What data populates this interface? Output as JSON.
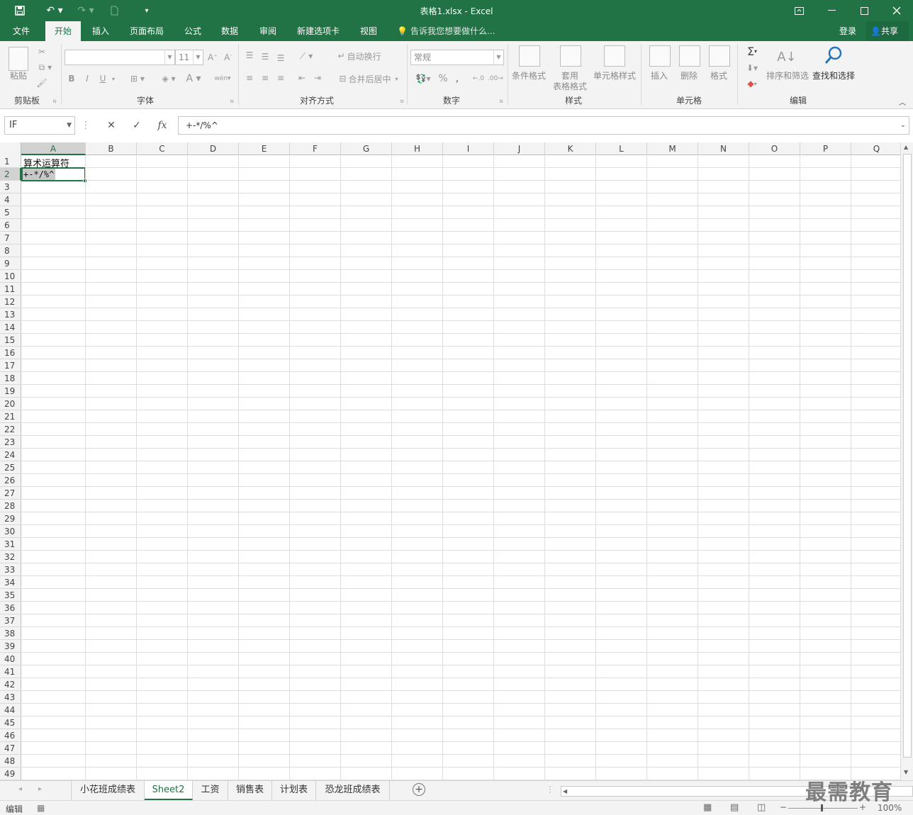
{
  "titlebar": {
    "title": "表格1.xlsx - Excel",
    "save_icon": "save-icon",
    "undo_icon": "undo-icon",
    "redo_icon": "redo-icon",
    "new_icon": "new-file-icon",
    "customize_icon": "customize-quick-access-icon",
    "ribbon_display_icon": "ribbon-display-options-icon",
    "minimize_icon": "minimize-icon",
    "maximize_icon": "maximize-icon",
    "close_icon": "close-icon"
  },
  "menu": {
    "tabs": [
      "文件",
      "开始",
      "插入",
      "页面布局",
      "公式",
      "数据",
      "审阅",
      "新建选项卡",
      "视图"
    ],
    "active_tab": "开始",
    "tell_me": "告诉我您想要做什么...",
    "login": "登录",
    "share": "共享"
  },
  "ribbon": {
    "clipboard": {
      "paste": "粘贴",
      "label": "剪贴板"
    },
    "font": {
      "font_name": "",
      "font_size": "11",
      "bold": "B",
      "italic": "I",
      "underline": "U",
      "label": "字体"
    },
    "alignment": {
      "wrap_text": "自动换行",
      "merge_center": "合并后居中",
      "label": "对齐方式"
    },
    "number": {
      "format": "常规",
      "percent": "%",
      "comma": ",",
      "label": "数字"
    },
    "styles": {
      "conditional": "条件格式",
      "table_line1": "套用",
      "table_line2": "表格格式",
      "cell_styles": "单元格样式",
      "label": "样式"
    },
    "cells": {
      "insert": "插入",
      "delete": "删除",
      "format": "格式",
      "label": "单元格"
    },
    "editing": {
      "sort_filter": "排序和筛选",
      "find_select": "查找和选择",
      "label": "编辑"
    }
  },
  "formula_bar": {
    "name_box": "IF",
    "cancel_icon": "cancel-icon",
    "enter_icon": "check-icon",
    "fx": "fx",
    "content": "+-*/%^"
  },
  "grid": {
    "columns": [
      "A",
      "B",
      "C",
      "D",
      "E",
      "F",
      "G",
      "H",
      "I",
      "J",
      "K",
      "L",
      "M",
      "N",
      "O",
      "P",
      "Q"
    ],
    "selected_column": "A",
    "row_count": 49,
    "selected_row": 2,
    "cells": {
      "A1": "算术运算符",
      "A2": "+-*/%^"
    }
  },
  "sheets": {
    "tabs": [
      "小花班成绩表",
      "Sheet2",
      "工资",
      "销售表",
      "计划表",
      "恐龙班成绩表"
    ],
    "active": "Sheet2"
  },
  "status": {
    "mode": "编辑",
    "zoom": "100%"
  },
  "watermark": "最需教育",
  "colors": {
    "accent": "#217346",
    "ribbon_bg": "#f3f3f3"
  }
}
